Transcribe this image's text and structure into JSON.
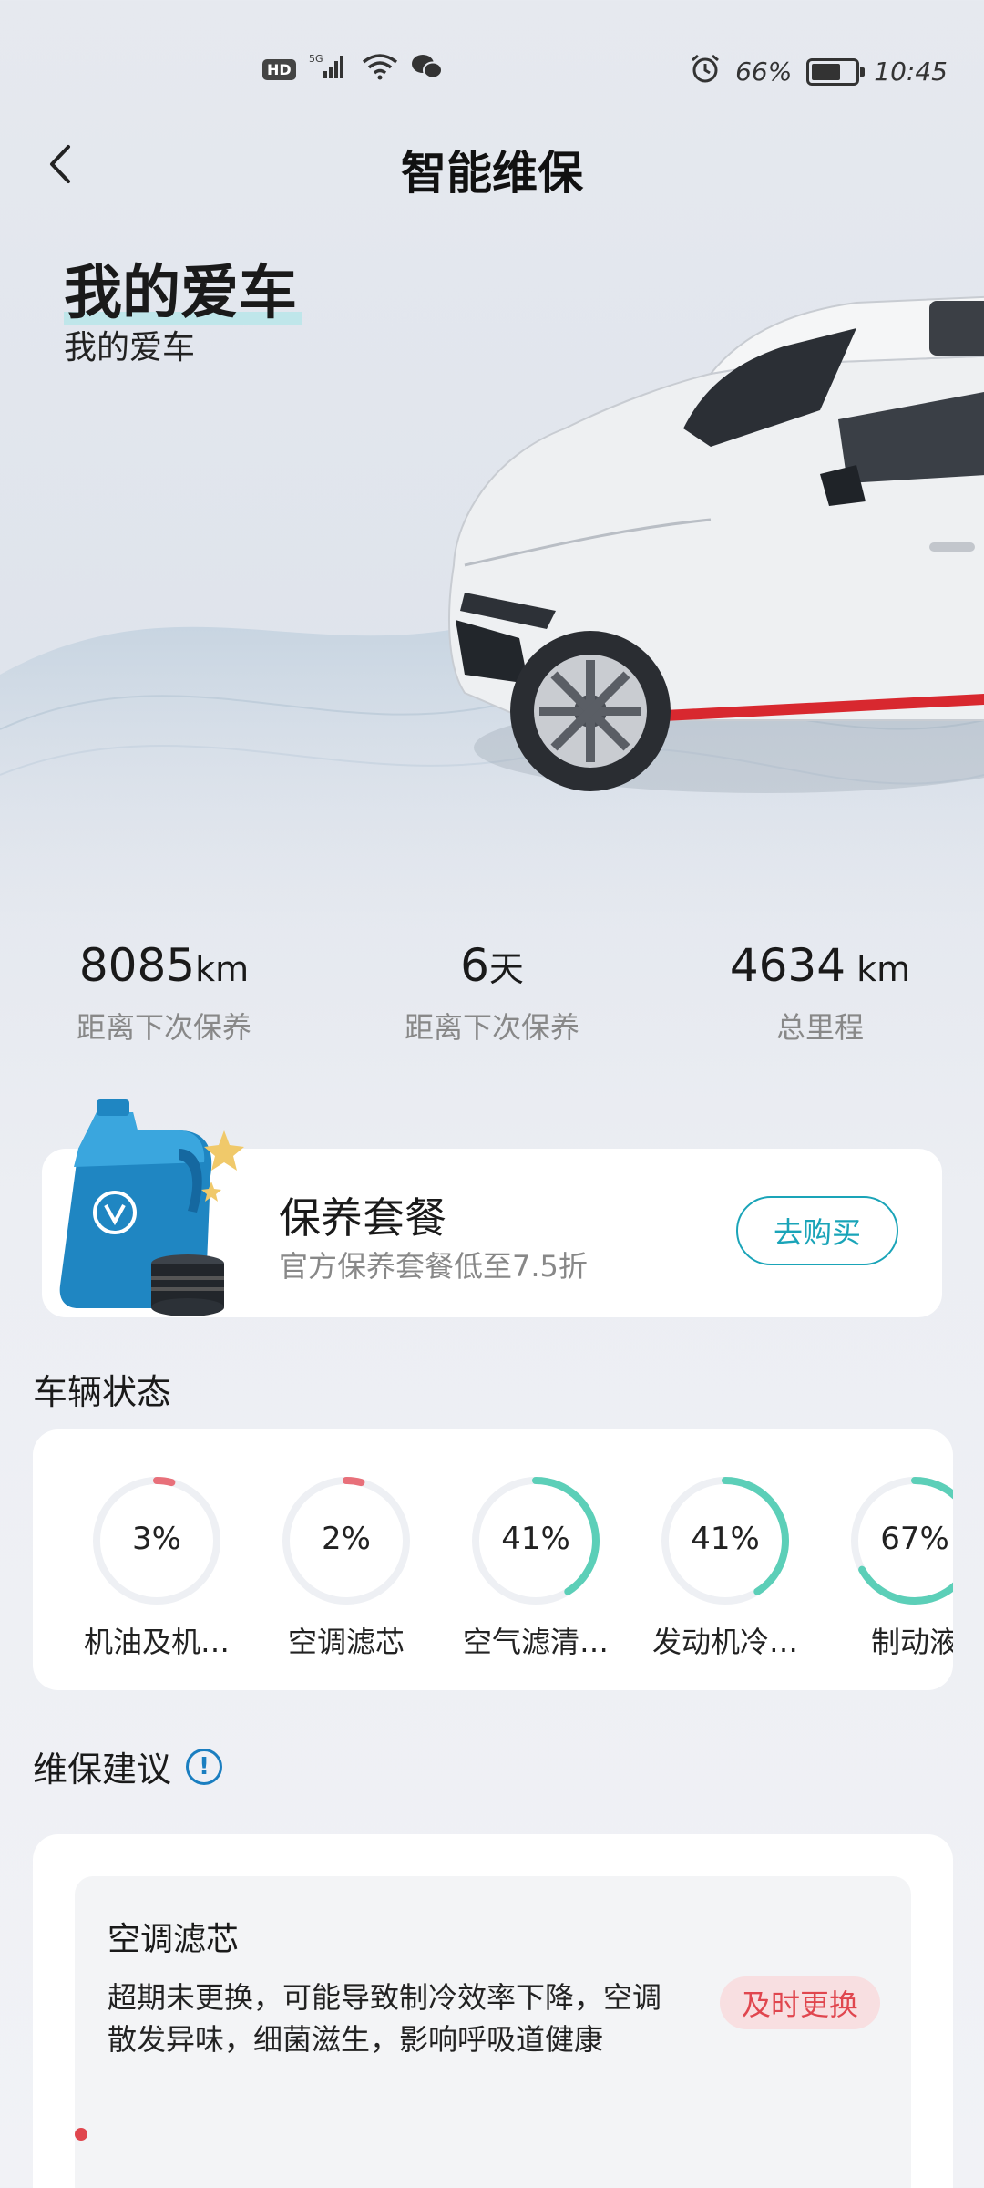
{
  "status_bar": {
    "hd": "HD",
    "network": "5G",
    "battery_percent": "66%",
    "battery_level": 0.66,
    "time": "10:45"
  },
  "header": {
    "title": "智能维保",
    "back_icon": "chevron-left-icon"
  },
  "hero": {
    "title": "我的爱车",
    "subtitle": "我的爱车"
  },
  "stats": [
    {
      "value": "8085",
      "unit": "km",
      "label": "距离下次保养"
    },
    {
      "value": "6",
      "unit": "天",
      "label": "距离下次保养"
    },
    {
      "value": "4634",
      "unit": " km",
      "label": "总里程"
    }
  ],
  "package": {
    "title": "保养套餐",
    "subtitle": "官方保养套餐低至7.5折",
    "button": "去购买"
  },
  "vehicle_status": {
    "title": "车辆状态",
    "items": [
      {
        "pct": "3%",
        "value": 0.03,
        "label": "机油及机…",
        "color": "#e8707a"
      },
      {
        "pct": "2%",
        "value": 0.02,
        "label": "空调滤芯",
        "color": "#e8707a"
      },
      {
        "pct": "41%",
        "value": 0.41,
        "label": "空气滤清…",
        "color": "#5ccfb8"
      },
      {
        "pct": "41%",
        "value": 0.41,
        "label": "发动机冷…",
        "color": "#5ccfb8"
      },
      {
        "pct": "67%",
        "value": 0.67,
        "label": "制动液",
        "color": "#5ccfb8"
      }
    ]
  },
  "advice": {
    "title": "维保建议",
    "info_icon": "info-icon",
    "item": {
      "title": "空调滤芯",
      "desc": "超期未更换，可能导致制冷效率下降，空调散发异味，细菌滋生，影响呼吸道健康",
      "badge": "及时更换"
    }
  }
}
